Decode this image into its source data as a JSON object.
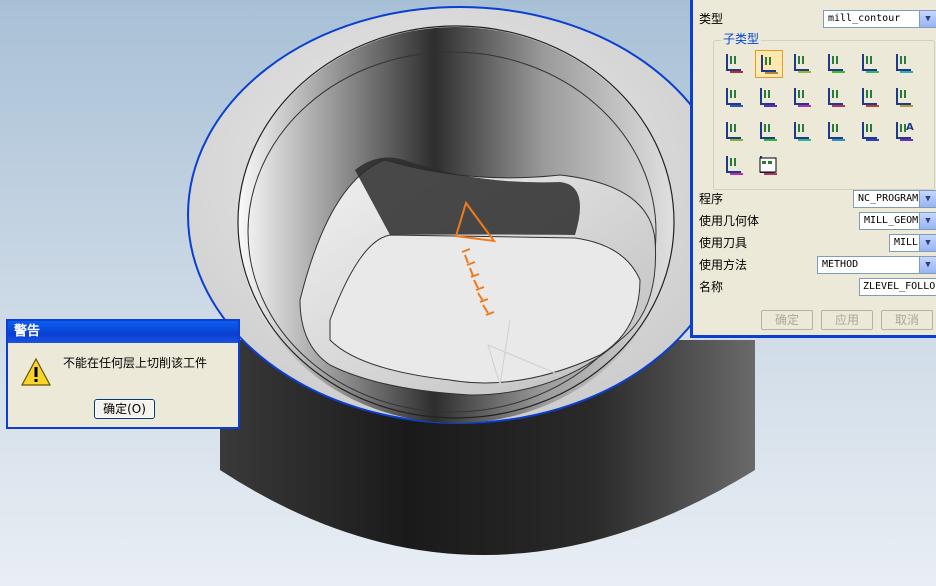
{
  "viewport": {
    "label": "3D graphics window"
  },
  "operation_dialog": {
    "type_label": "类型",
    "type_value": "mill_contour",
    "subtype_legend": "子类型",
    "subtype_icons": [
      "cavity-mill-icon",
      "plunge-mill-icon",
      "corner-rough-icon",
      "rest-mill-icon",
      "zlevel-profile-icon",
      "zlevel-corner-icon",
      "fixed-contour-icon",
      "contour-area-icon",
      "contour-surface-area-icon",
      "streamline-icon",
      "contour-area-dir-steep-icon",
      "flowcut-single-icon",
      "flowcut-multiple-icon",
      "flowcut-ref-tool-icon",
      "flowcut-smooth-icon",
      "solid-profile-3d-icon",
      "profile-3d-icon",
      "contour-text-icon",
      "mill-user-icon",
      "mill-control-icon"
    ],
    "selected_subtype_index": 1,
    "program_label": "程序",
    "program_value": "NC_PROGRAM",
    "geometry_label": "使用几何体",
    "geometry_value": "MILL_GEOM",
    "tool_label": "使用刀具",
    "tool_value": "MILL",
    "method_label": "使用方法",
    "method_value": "METHOD",
    "name_label": "名称",
    "name_value": "ZLEVEL_FOLLO",
    "ok_label": "确定",
    "apply_label": "应用",
    "cancel_label": "取消"
  },
  "warning_dialog": {
    "title": "警告",
    "message": "不能在任何层上切削该工件",
    "ok_label": "确定(O)"
  },
  "colors": {
    "background_top": "#a9c1d7",
    "background_bottom": "#e6ecf3",
    "selection_blue": "#0a3fd1",
    "tool_orange": "#f07a1a"
  }
}
